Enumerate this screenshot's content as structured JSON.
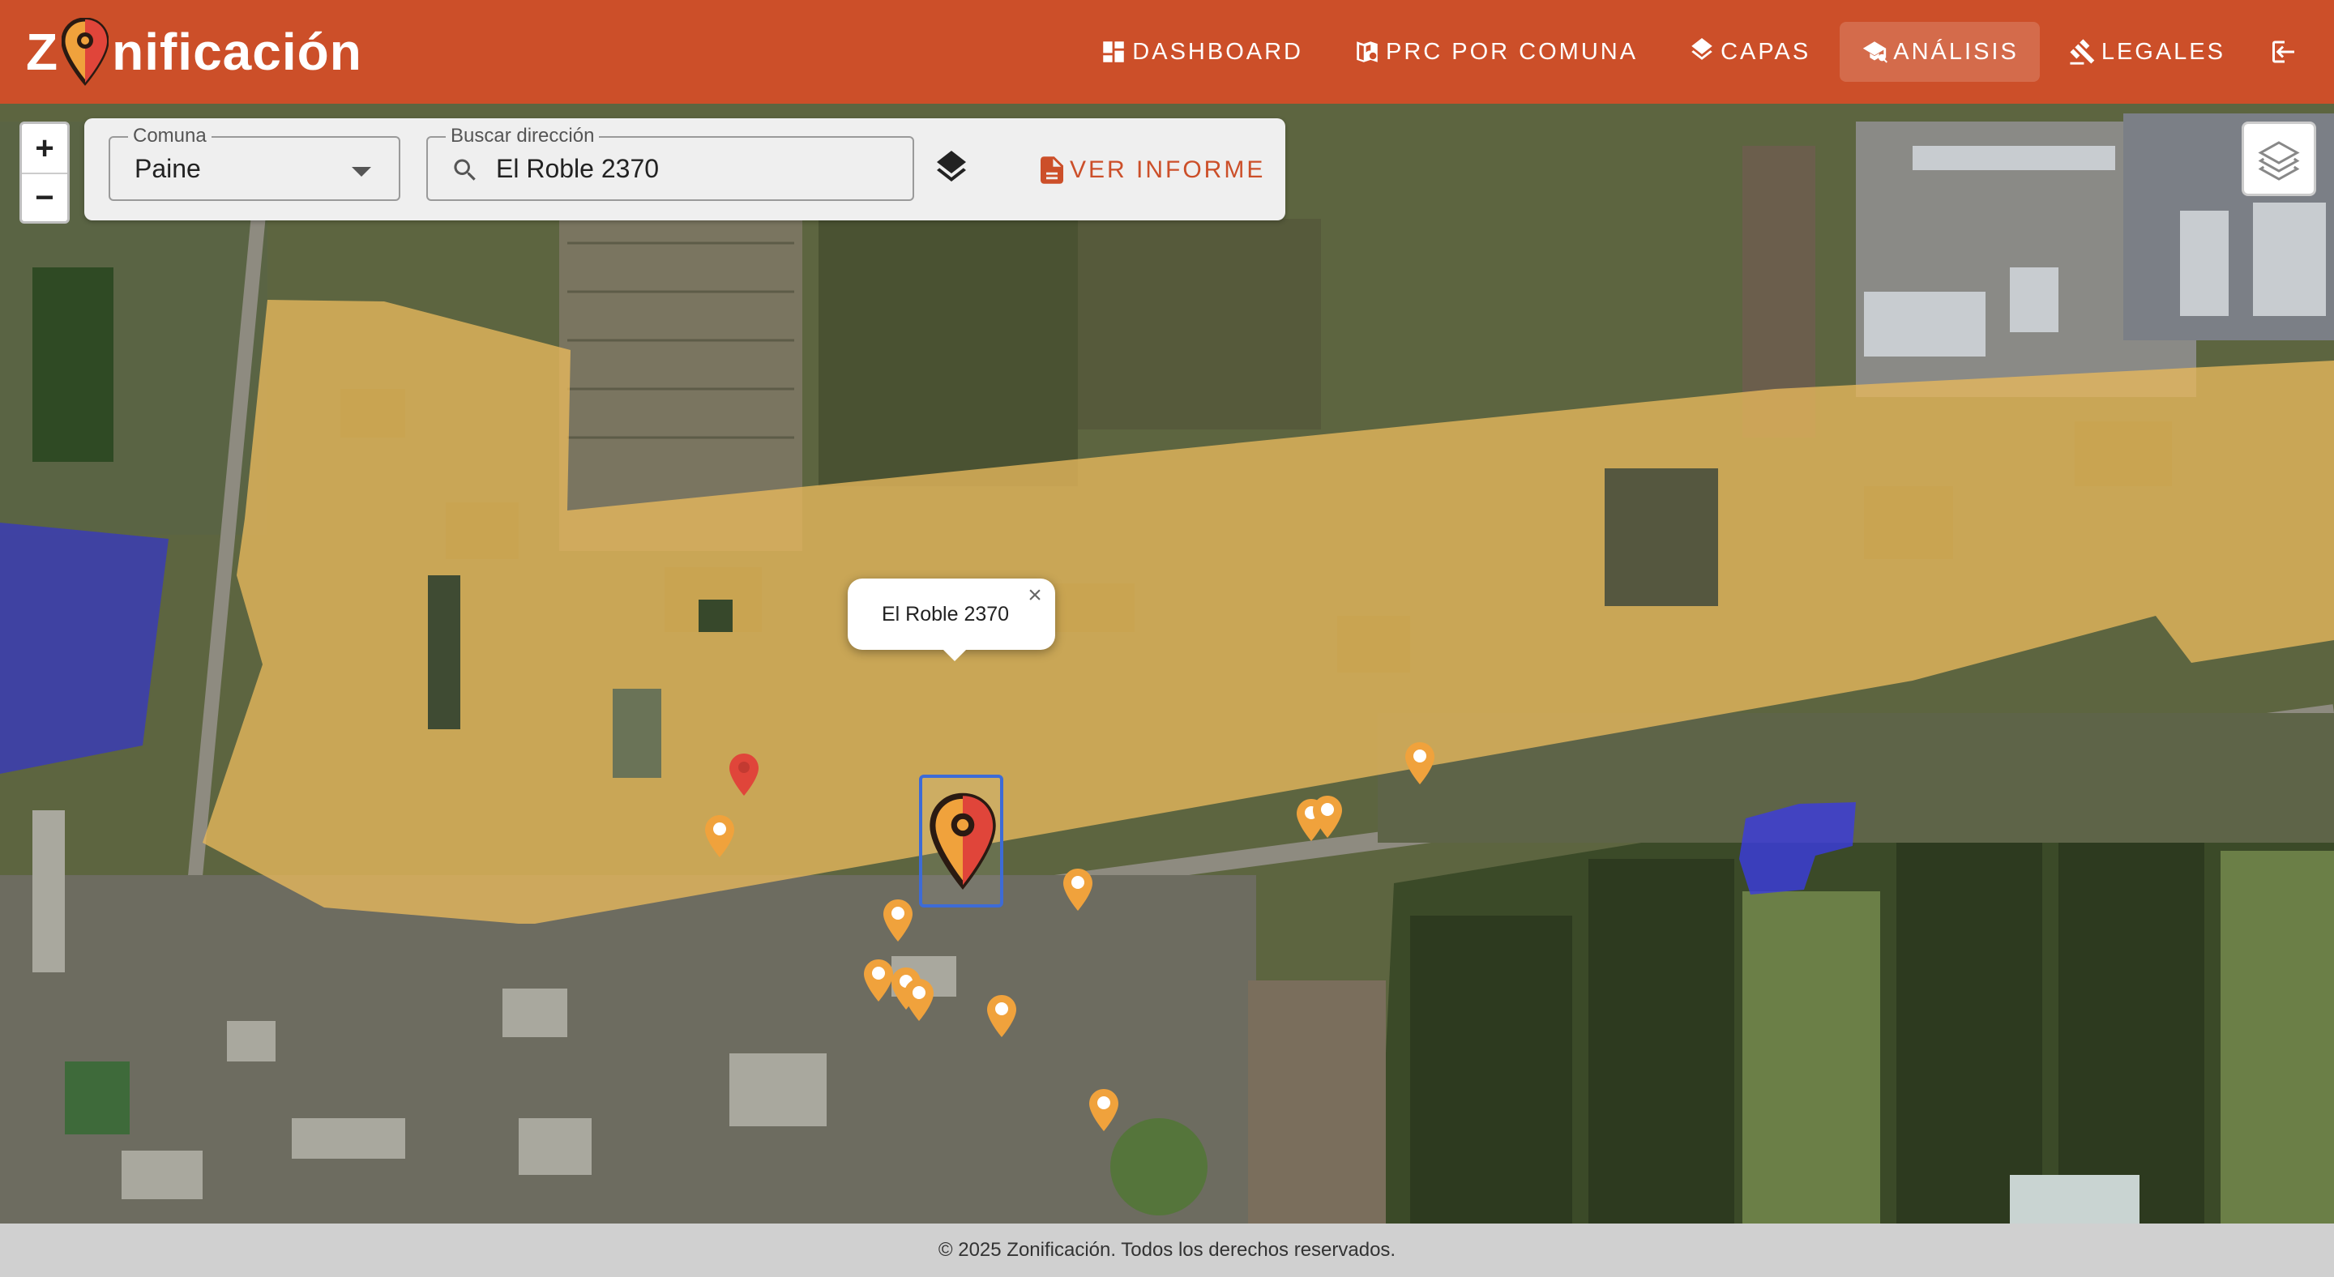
{
  "brand": {
    "prefix": "Z",
    "suffix": "nificación"
  },
  "nav": [
    {
      "label": "DASHBOARD",
      "icon": "dashboard-icon"
    },
    {
      "label": "PRC POR COMUNA",
      "icon": "map-search-icon"
    },
    {
      "label": "CAPAS",
      "icon": "layers-icon"
    },
    {
      "label": "ANÁLISIS",
      "icon": "analysis-icon",
      "active": true
    },
    {
      "label": "LEGALES",
      "icon": "gavel-icon"
    }
  ],
  "logout_icon": "logout-icon",
  "controls": {
    "comuna_label": "Comuna",
    "comuna_value": "Paine",
    "search_label": "Buscar dirección",
    "search_value": "El Roble 2370",
    "report_label": "VER INFORME"
  },
  "zoom": {
    "in": "+",
    "out": "−"
  },
  "popup": {
    "text": "El Roble 2370",
    "close": "×"
  },
  "colors": {
    "accent": "#cc4f29",
    "zone_yellow": "#e8b85c",
    "zone_blue": "#3b3bd9",
    "marker_orange": "#f0a23c",
    "marker_red": "#e0453a"
  },
  "footer": "© 2025 Zonificación. Todos los derechos reservados."
}
